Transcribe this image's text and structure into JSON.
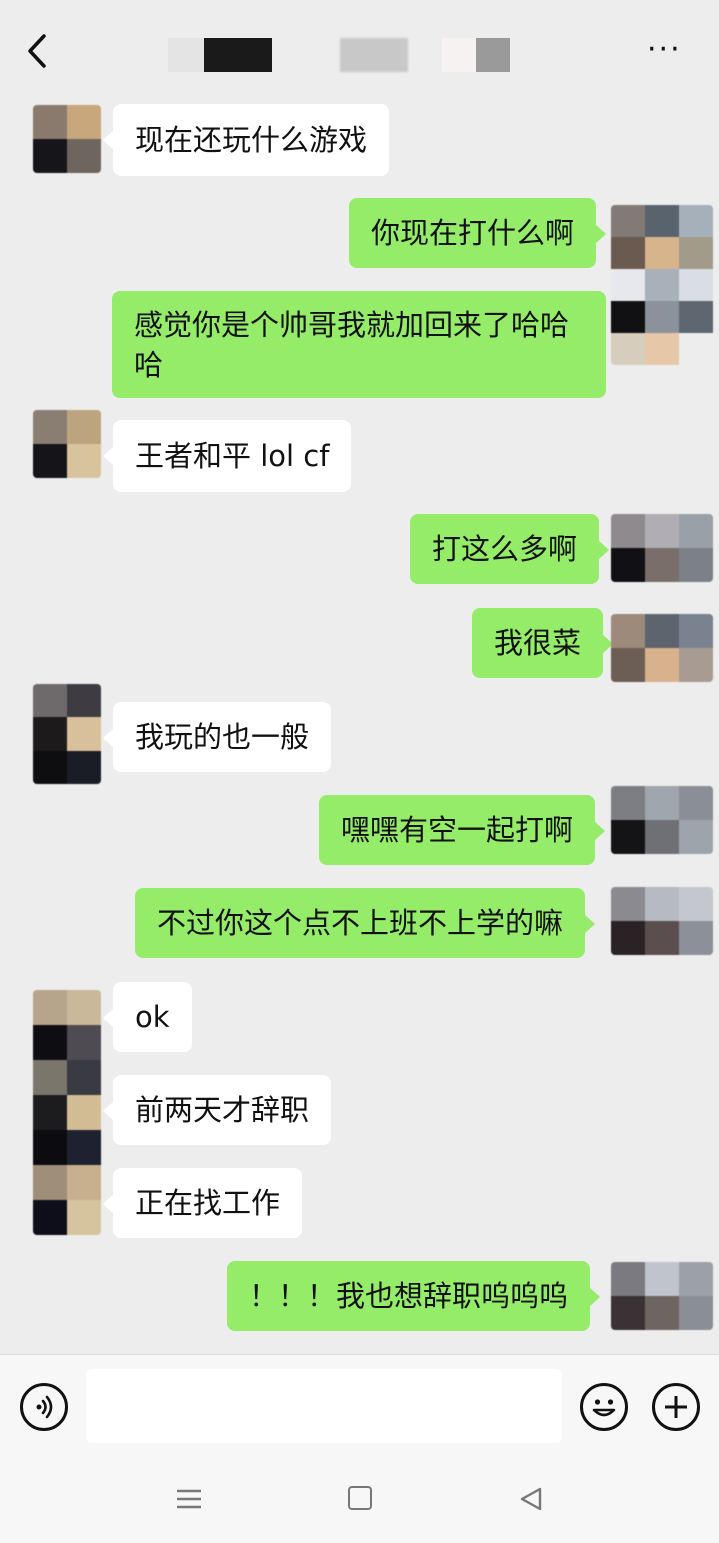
{
  "header": {
    "back_icon": "chevron-left-icon",
    "title_text": "",
    "more_label": "···"
  },
  "messages": [
    {
      "side": "in",
      "text": "现在还玩什么游戏"
    },
    {
      "side": "out",
      "text": "你现在打什么啊"
    },
    {
      "side": "out",
      "text": "感觉你是个帅哥我就加回来了哈哈哈"
    },
    {
      "side": "in",
      "text": "王者和平   lol  cf"
    },
    {
      "side": "out",
      "text": "打这么多啊"
    },
    {
      "side": "out",
      "text": "我很菜"
    },
    {
      "side": "in",
      "text": "我玩的也一般"
    },
    {
      "side": "out",
      "text": "嘿嘿有空一起打啊"
    },
    {
      "side": "out",
      "text": "不过你这个点不上班不上学的嘛"
    },
    {
      "side": "in",
      "text": "ok"
    },
    {
      "side": "in",
      "text": "前两天才辞职"
    },
    {
      "side": "in",
      "text": "正在找工作"
    },
    {
      "side": "out",
      "text": "！！！我也想辞职呜呜呜"
    }
  ],
  "input_bar": {
    "voice_icon": "voice-icon",
    "text_value": "",
    "emoji_icon": "emoji-icon",
    "plus_icon": "plus-icon"
  },
  "nav_bar": {
    "menu_icon": "menu-icon",
    "home_icon": "home-square-icon",
    "back_icon": "back-triangle-icon"
  },
  "colors": {
    "background": "#ededed",
    "outgoing_bubble": "#95ec69",
    "incoming_bubble": "#ffffff"
  }
}
